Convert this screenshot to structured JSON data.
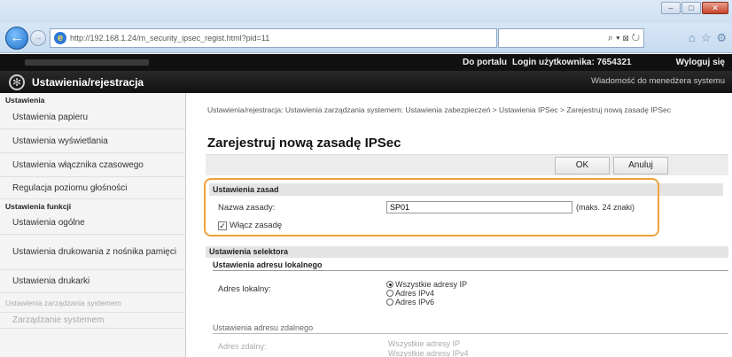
{
  "browser": {
    "url": "http://192.168.1.24/m_security_ipsec_regist.html?pid=11",
    "search_glyph": "⌕ ▾ ⊠ ↻",
    "window_controls": [
      "–",
      "□",
      "✕"
    ]
  },
  "header": {
    "portal_link": "Do portalu",
    "login_label": "Login użytkownika:  7654321",
    "logout_link": "Wyloguj się",
    "message_link": "Wiadomość do menedżera systemu",
    "app_title": "Ustawienia/rejestracja"
  },
  "sidebar": {
    "sections": [
      {
        "title": "Ustawienia",
        "items": [
          "Ustawienia papieru",
          "Ustawienia wyświetlania",
          "Ustawienia włącznika czasowego",
          "Regulacja poziomu głośności"
        ]
      },
      {
        "title": "Ustawienia funkcji",
        "items": [
          "Ustawienia ogólne",
          "Ustawienia drukowania z nośnika pamięci",
          "Ustawienia drukarki"
        ]
      }
    ],
    "faded_items": [
      "Ustawienia zarządzania systemem",
      "Zarządzanie systemem"
    ]
  },
  "main": {
    "breadcrumb": "Ustawienia/rejestracja: Ustawienia zarządzania systemem: Ustawienia zabezpieczeń > Ustawienia IPSec > Zarejestruj nową zasadę IPSec",
    "title": "Zarejestruj nową zasadę IPSec",
    "ok_button": "OK",
    "cancel_button": "Anuluj",
    "policy": {
      "section_title": "Ustawienia zasad",
      "name_label": "Nazwa zasady:",
      "name_value": "SP01",
      "max_note": "(maks. 24 znaki)",
      "enable_label": "Włącz zasadę",
      "enable_checked": true
    },
    "selector": {
      "section_title": "Ustawienia selektora",
      "local_title": "Ustawienia adresu lokalnego",
      "local_label": "Adres lokalny:",
      "local_options": [
        "Wszystkie adresy IP",
        "Adres IPv4",
        "Adres IPv6"
      ],
      "local_selected": 0,
      "remote_title": "Ustawienia adresu zdalnego",
      "remote_label": "Adres zdalny:",
      "remote_options": [
        "Wszystkie adresy IP",
        "Wszystkie adresy IPv4"
      ]
    }
  },
  "colors": {
    "highlight": "#f0a23c",
    "appbar": "#111111"
  }
}
